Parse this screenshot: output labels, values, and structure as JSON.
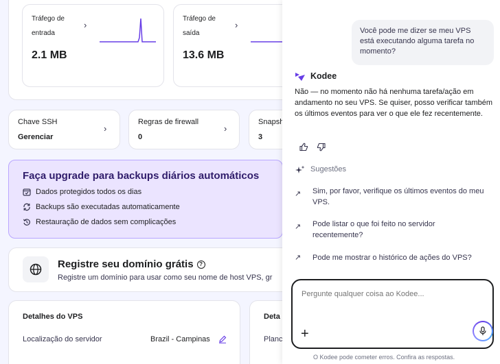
{
  "traffic": {
    "in_label": "Tráfego de entrada",
    "in_value": "2.1 MB",
    "out_label": "Tráfego de saída",
    "out_value": "13.6 MB"
  },
  "quick": {
    "ssh_label": "Chave SSH",
    "ssh_value": "Gerenciar",
    "fw_label": "Regras de firewall",
    "fw_value": "0",
    "snap_label": "Snapsh",
    "snap_value": "3"
  },
  "upgrade": {
    "title": "Faça upgrade para backups diários automáticos",
    "features": [
      "Dados protegidos todos os dias",
      "Backups são executadas automaticamente",
      "Restauração de dados sem complicações"
    ]
  },
  "domain": {
    "title": "Registre seu domínio grátis",
    "subtitle": "Registre um domínio para usar como seu nome de host VPS, gr"
  },
  "details": {
    "title": "Detalhes do VPS",
    "location_label": "Localização do servidor",
    "location_value": "Brazil - Campinas",
    "title2": "Deta",
    "plan_label": "Planc"
  },
  "chat": {
    "user_message": "Você pode me dizer se meu VPS está executando alguma tarefa no momento?",
    "assistant_name": "Kodee",
    "assistant_reply": "Não — no momento não há nenhuma tarefa/ação em andamento no seu VPS. Se quiser, posso verificar também os últimos eventos para ver o que ele fez recentemente.",
    "suggestions_title": "Sugestões",
    "suggestions": [
      "Sim, por favor, verifique os últimos eventos do meu VPS.",
      "Pode listar o que foi feito no servidor recentemente?",
      "Pode me mostrar o histórico de ações do VPS?"
    ],
    "input_placeholder": "Pergunte qualquer coisa ao Kodee...",
    "disclaimer": "O Kodee pode cometer erros. Confira as respostas."
  },
  "colors": {
    "accent": "#673de6",
    "upgrade_bg": "#ebe4ff"
  }
}
